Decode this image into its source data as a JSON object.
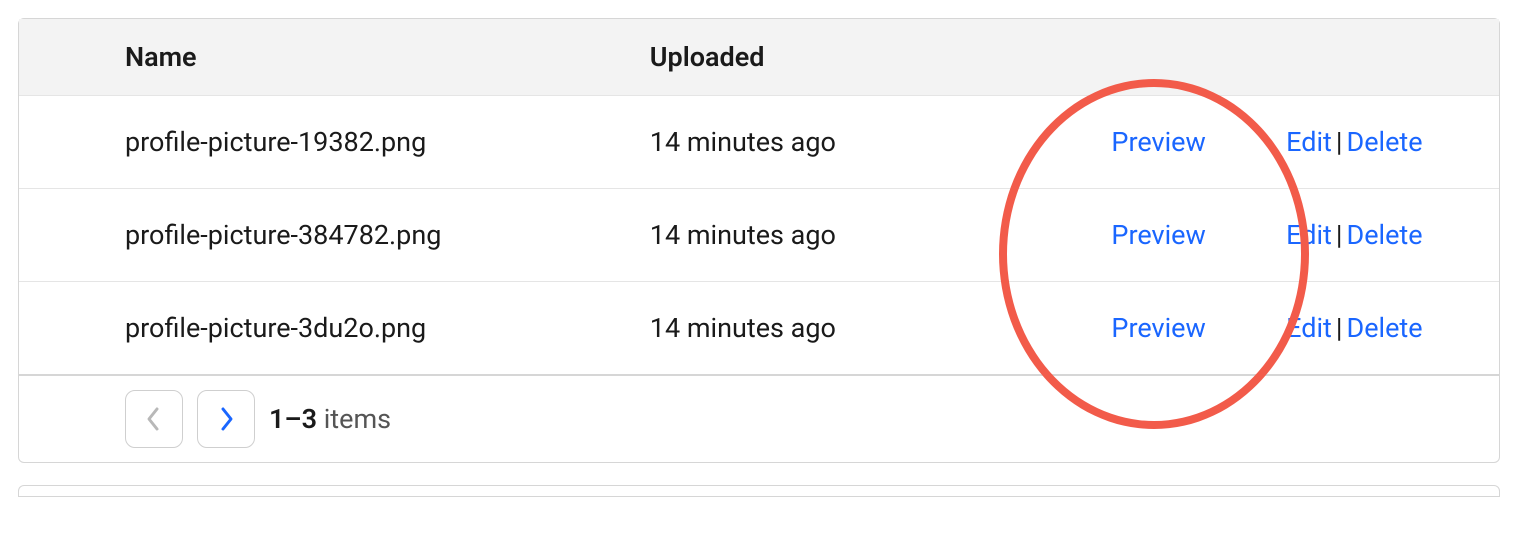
{
  "table": {
    "headers": {
      "name": "Name",
      "uploaded": "Uploaded"
    },
    "actions": {
      "preview": "Preview",
      "edit": "Edit",
      "delete": "Delete",
      "separator": "|"
    },
    "rows": [
      {
        "name": "profile-picture-19382.png",
        "uploaded": "14 minutes ago"
      },
      {
        "name": "profile-picture-384782.png",
        "uploaded": "14 minutes ago"
      },
      {
        "name": "profile-picture-3du2o.png",
        "uploaded": "14 minutes ago"
      }
    ]
  },
  "pagination": {
    "range": "1–3",
    "items_label": " items"
  }
}
